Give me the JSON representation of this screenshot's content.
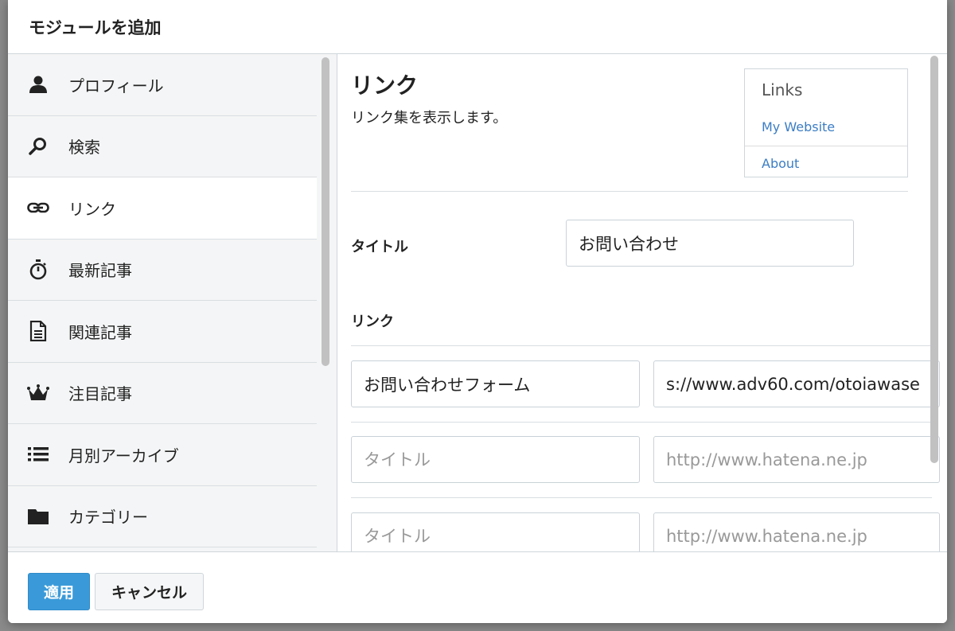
{
  "modal": {
    "title": "モジュールを追加"
  },
  "sidebar": {
    "items": [
      {
        "label": "プロフィール",
        "icon": "user-icon"
      },
      {
        "label": "検索",
        "icon": "search-icon"
      },
      {
        "label": "リンク",
        "icon": "link-icon"
      },
      {
        "label": "最新記事",
        "icon": "stopwatch-icon"
      },
      {
        "label": "関連記事",
        "icon": "document-icon"
      },
      {
        "label": "注目記事",
        "icon": "crown-icon"
      },
      {
        "label": "月別アーカイブ",
        "icon": "list-icon"
      },
      {
        "label": "カテゴリー",
        "icon": "folder-icon"
      }
    ],
    "active": "リンク"
  },
  "main": {
    "module_title": "リンク",
    "module_description": "リンク集を表示します。",
    "preview": {
      "heading": "Links",
      "links": [
        "My Website",
        "About"
      ]
    },
    "title_label": "タイトル",
    "title_value": "お問い合わせ",
    "links_label": "リンク",
    "link_rows": [
      {
        "title_value": "お問い合わせフォーム",
        "title_placeholder": "タイトル",
        "url_value": "s://www.adv60.com/otoiawase",
        "url_placeholder": "http://www.hatena.ne.jp"
      },
      {
        "title_value": "",
        "title_placeholder": "タイトル",
        "url_value": "",
        "url_placeholder": "http://www.hatena.ne.jp"
      },
      {
        "title_value": "",
        "title_placeholder": "タイトル",
        "url_value": "",
        "url_placeholder": "http://www.hatena.ne.jp"
      }
    ]
  },
  "footer": {
    "apply_label": "適用",
    "cancel_label": "キャンセル"
  },
  "colors": {
    "accent": "#3a9ad9",
    "link": "#3b7dc4"
  }
}
